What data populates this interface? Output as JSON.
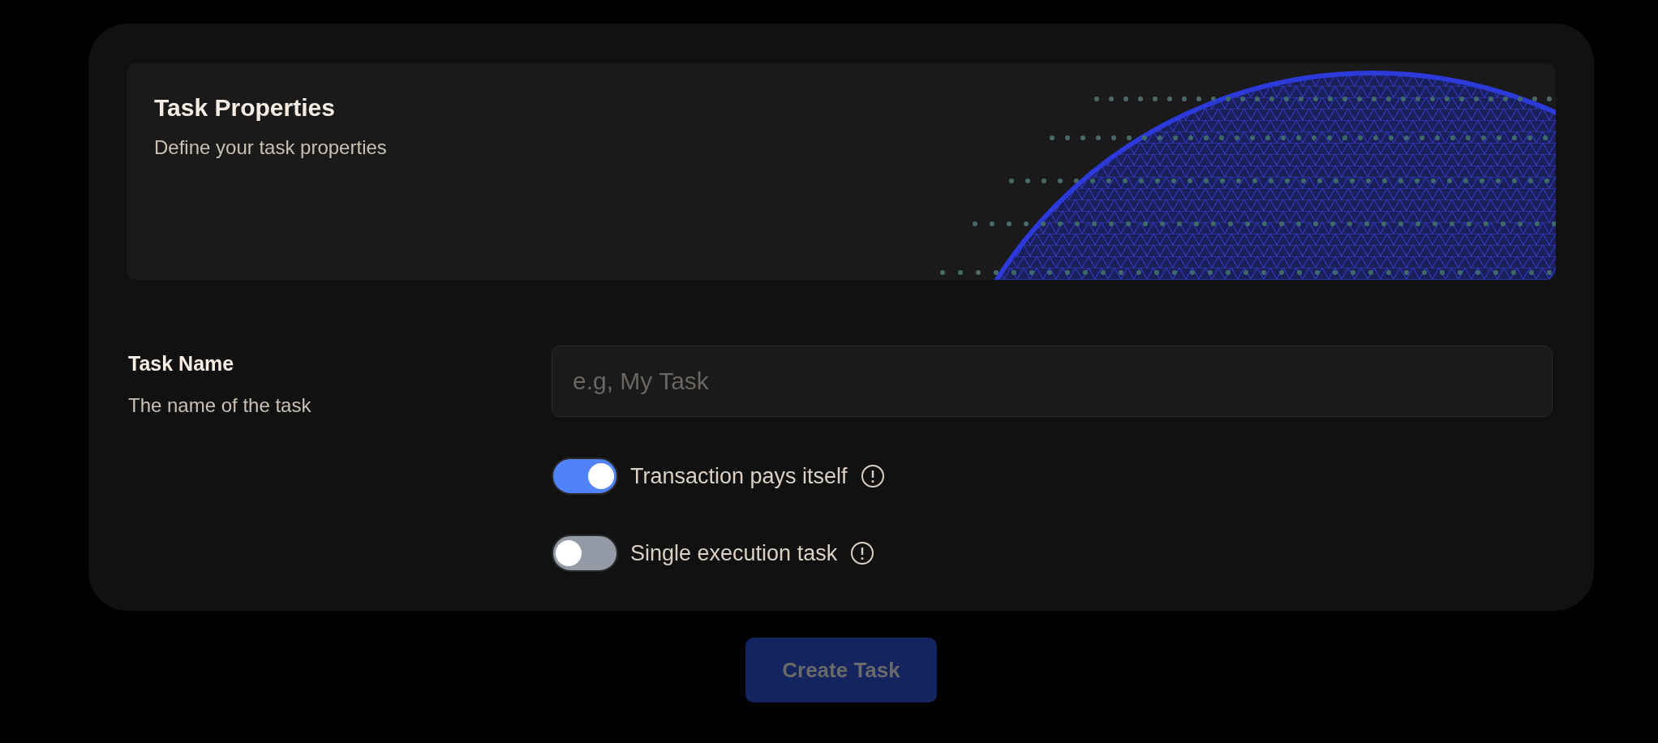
{
  "header": {
    "title": "Task Properties",
    "subtitle": "Define your task properties"
  },
  "task_name": {
    "label": "Task Name",
    "description": "The name of the task",
    "placeholder": "e.g, My Task"
  },
  "toggles": [
    {
      "label": "Transaction pays itself",
      "on": true
    },
    {
      "label": "Single execution task",
      "on": false
    }
  ],
  "create_button": {
    "label": "Create Task",
    "disabled": true
  }
}
